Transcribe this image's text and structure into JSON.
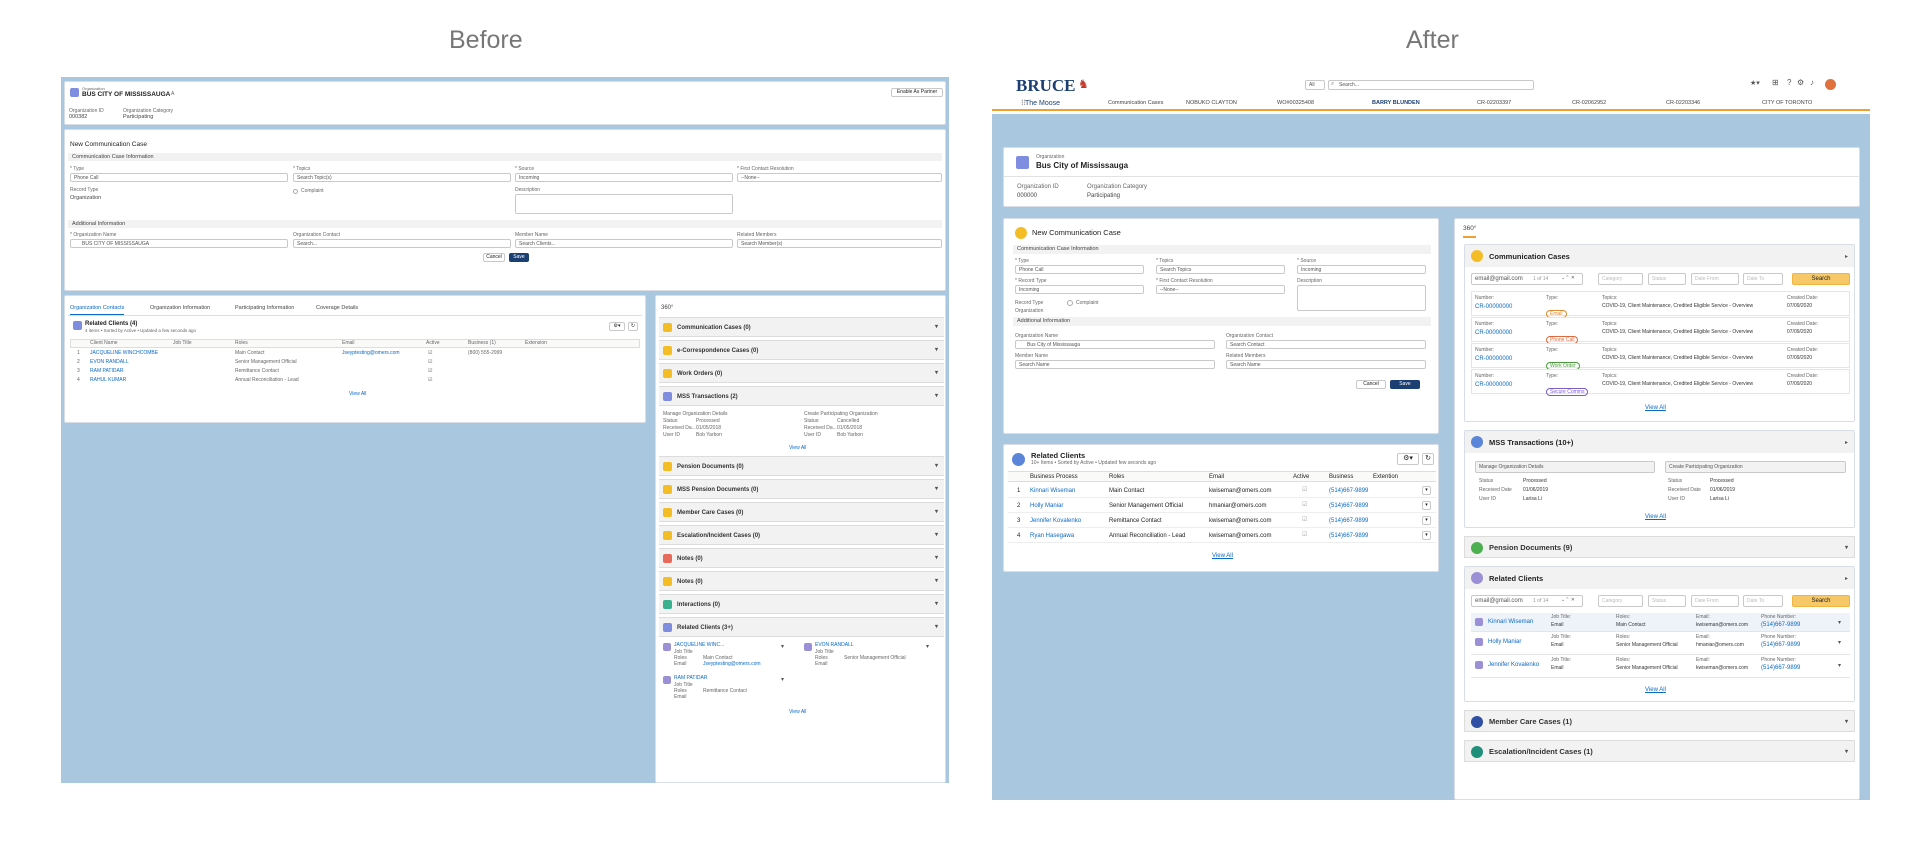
{
  "captions": {
    "before": "Before",
    "after": "After"
  },
  "before": {
    "org": {
      "type_label": "Organization",
      "name": "BUS CITY OF MISSISSAUGA",
      "badge": "A",
      "enable_btn": "Enable As Partner",
      "id_label": "Organization ID",
      "id_value": "000382",
      "cat_label": "Organization Category",
      "cat_value": "Participating"
    },
    "form": {
      "title": "New Communication Case",
      "section1": "Communication Case Information",
      "type_label": "* Type",
      "type_value": "Phone Call",
      "topics_label": "* Topics",
      "topics_ph": "Search Topic(s)",
      "source_label": "* Source",
      "source_value": "Incoming",
      "fcr_label": "* First Contact Resolution",
      "fcr_value": "--None--",
      "record_type_label": "Record Type",
      "record_type_value": "Organization",
      "complaint": "Complaint",
      "desc_label": "Description",
      "section2": "Additional Information",
      "orgname_label": "* Organization Name",
      "orgname_value": "BUS CITY OF MISSISSAUGA",
      "orgcontact_label": "Organization Contact",
      "orgcontact_ph": "Search...",
      "member_label": "Member Name",
      "member_ph": "Search Clients...",
      "related_label": "Related Members",
      "related_ph": "Search Member(s)",
      "cancel": "Cancel",
      "save": "Save"
    },
    "tabs": [
      "Organization Contacts",
      "Organization Information",
      "Participating Information",
      "Coverage Details"
    ],
    "related": {
      "title": "Related Clients (4)",
      "sub": "4 items • Sorted by Active • Updated a few seconds ago",
      "cols": [
        "Client Name",
        "Job Title",
        "Roles",
        "Email",
        "Active",
        "Business (1)",
        "Extension"
      ],
      "rows": [
        {
          "n": "1",
          "name": "JACQUELINE WINCHCOMBE",
          "role": "Main Contact",
          "email": "Jseyptesting@omers.com",
          "phone": "(800) 555-2999"
        },
        {
          "n": "2",
          "name": "EVON RANDALL",
          "role": "Senior Management Official",
          "email": "",
          "phone": ""
        },
        {
          "n": "3",
          "name": "RAM PATIDAR",
          "role": "Remittance Contact",
          "email": "",
          "phone": ""
        },
        {
          "n": "4",
          "name": "RAHUL KUMAR",
          "role": "Annual Reconciliation - Lead",
          "email": "",
          "phone": ""
        }
      ],
      "view_all": "View All"
    },
    "p360": {
      "title": "360°",
      "sections": [
        "Communication Cases (0)",
        "e-Correspondence Cases (0)",
        "Work Orders (0)",
        "MSS Transactions (2)"
      ],
      "mss": {
        "a_title": "Manage Organization Details",
        "a_status": "Status:",
        "a_status_v": "Processed",
        "a_recv": "Received Da...",
        "a_recv_v": "01/05/2018",
        "a_user": "User ID",
        "a_user_v": "Bob Yarbon",
        "b_title": "Create Participating Organization",
        "b_status_v": "Cancelled",
        "b_recv_v": "01/05/2018",
        "b_user_v": "Bob Yarbon",
        "view_all": "View All"
      },
      "sections2": [
        "Pension Documents (0)",
        "MSS Pension Documents (0)",
        "Member Care Cases (0)",
        "Escalation/Incident Cases (0)",
        "Notes (0)",
        "Notes (0)",
        "Interactions (0)",
        "Related Clients (3+)"
      ],
      "rc": [
        {
          "name": "JACQUELINE WINC...",
          "job": "Job Title",
          "roles": "Roles",
          "roles_v": "Main Contact",
          "email": "Email",
          "email_v": "Jseyptesting@omers.com"
        },
        {
          "name": "EVON RANDALL",
          "job": "Job Title",
          "roles": "Roles",
          "roles_v": "Senior Management Official",
          "email": "Email",
          "email_v": ""
        },
        {
          "name": "RAM PATIDAR",
          "job": "Job Title",
          "roles": "Roles",
          "roles_v": "Remittance Contact",
          "email": "Email",
          "email_v": ""
        }
      ],
      "view_all": "View All"
    }
  },
  "after": {
    "brand": {
      "name": "BRUCE",
      "sub": "The Moose"
    },
    "search": {
      "scope": "All",
      "placeholder": "Search..."
    },
    "navtabs": [
      "Communication Cases",
      "NOBUKO CLAYTON",
      "WO#00325408",
      "BARRY BLUNDEN",
      "CR-02203397",
      "CR-02062952",
      "CR-02203346",
      "CITY OF TORONTO"
    ],
    "org": {
      "type_label": "Organization",
      "name": "Bus City of Mississauga",
      "id_label": "Organization ID",
      "id_value": "000000",
      "cat_label": "Organization Category",
      "cat_value": "Participating"
    },
    "form": {
      "title": "New Communication Case",
      "section1": "Communication Case Information",
      "type_label": "* Type",
      "type_value": "Phone Call",
      "topics_label": "* Topics",
      "topics_ph": "Search Topics",
      "source_label": "* Source",
      "source_value": "Incoming",
      "rtype_label": "* Record Type",
      "rtype_value": "Incoming",
      "fcr_label": "* First Contact Resolution",
      "fcr_value": "--None--",
      "desc_label": "Description",
      "record_type_label": "Record Type",
      "record_type_value": "Organization",
      "complaint": "Complaint",
      "section2": "Additional Information",
      "orgname_label": "Organization Name",
      "orgname_value": "Bus City of Mississauga",
      "orgcontact_label": "Organization Contact",
      "orgcontact_ph": "Search Contact",
      "member_label": "Member Name",
      "member_ph": "Search Name",
      "related_label": "Related Members",
      "related_ph": "Search Name",
      "cancel": "Cancel",
      "save": "Save"
    },
    "related": {
      "title": "Related Clients",
      "sub": "10+ Items • Sorted by Active • Updated few seconds ago",
      "cols": [
        "Business Process",
        "Roles",
        "Email",
        "Active",
        "Business",
        "Extention"
      ],
      "rows": [
        {
          "n": "1",
          "name": "Kinnari Wiseman",
          "role": "Main Contact",
          "email": "kwiseman@omers.com",
          "phone": "(514)667-9899"
        },
        {
          "n": "2",
          "name": "Holly Maniar",
          "role": "Senior Management Official",
          "email": "hmaniar@omers.com",
          "phone": "(514)667-9899"
        },
        {
          "n": "3",
          "name": "Jennifer Kovalenko",
          "role": "Remittance Contact",
          "email": "kwiseman@omers.com",
          "phone": "(514)667-9899"
        },
        {
          "n": "4",
          "name": "Ryan Hasegawa",
          "role": "Annual Reconciliation - Lead",
          "email": "kwiseman@omers.com",
          "phone": "(514)667-9899"
        }
      ],
      "view_all": "View All"
    },
    "p360": {
      "title": "360°",
      "cc": {
        "title": "Communication Cases",
        "filter": "email@gmail.com",
        "count": "1 of 14",
        "category": "Category",
        "status": "Status",
        "from": "Date From",
        "to": "Date To",
        "search": "Search",
        "labels": {
          "number": "Number:",
          "type": "Type:",
          "topics": "Topics:",
          "created": "Created Date:"
        },
        "rows": [
          {
            "num": "CR-00000000",
            "type": "Email",
            "topics": "COVID-19, Client Maintenance, Credited Eligible Service - Overview",
            "date": "07/09/2020"
          },
          {
            "num": "CR-00000000",
            "type": "Phone Call",
            "topics": "COVID-19, Client Maintenance, Credited Eligible Service - Overview",
            "date": "07/09/2020"
          },
          {
            "num": "CR-00000000",
            "type": "Work Order",
            "topics": "COVID-19, Client Maintenance, Credited Eligible Service - Overview",
            "date": "07/09/2020"
          },
          {
            "num": "CR-00000000",
            "type": "Secure Comms",
            "topics": "COVID-19, Client Maintenance, Credited Eligible Service - Overview",
            "date": "07/09/2020"
          }
        ],
        "view_all": "View All"
      },
      "mss": {
        "title": "MSS Transactions (10+)",
        "a_title": "Manage Organization Details",
        "b_title": "Create Participating Organization",
        "status": "Status",
        "status_v": "Processed",
        "recv": "Received Date",
        "recv_v": "01/06/2019",
        "user": "User ID",
        "user_v": "Larisa Li",
        "view_all": "View All"
      },
      "pension": "Pension Documents (9)",
      "rc": {
        "title": "Related Clients",
        "filter": "email@gmail.com",
        "count": "1 of 14",
        "category": "Category",
        "status": "Status",
        "from": "Date From",
        "to": "Date To",
        "search": "Search",
        "labels": {
          "job": "Job Title:",
          "roles": "Roles:",
          "email": "Email:",
          "phone": "Phone Number:"
        },
        "rows": [
          {
            "name": "Kinnari Wiseman",
            "job_v": "Email",
            "roles_v": "Main Contact",
            "email_v": "kwiseman@omers.com",
            "phone_v": "(514)667-9899"
          },
          {
            "name": "Holly Maniar",
            "job_v": "Email",
            "roles_v": "Senior Management Official",
            "email_v": "hmaniar@omers.com",
            "phone_v": "(514)667-9899"
          },
          {
            "name": "Jennifer Kovalenko",
            "job_v": "Email",
            "roles_v": "Senior Management Official",
            "email_v": "kwiseman@omers.com",
            "phone_v": "(514)667-9899"
          }
        ],
        "view_all": "View All"
      },
      "member": "Member Care Cases (1)",
      "escalation": "Escalation/Incident Cases (1)"
    }
  },
  "colors": {
    "frame": "#a9c7de",
    "accent": "#f4bc25",
    "navy": "#1b3f73",
    "link": "#0b69c7",
    "orange_bar": "#f0a030"
  }
}
